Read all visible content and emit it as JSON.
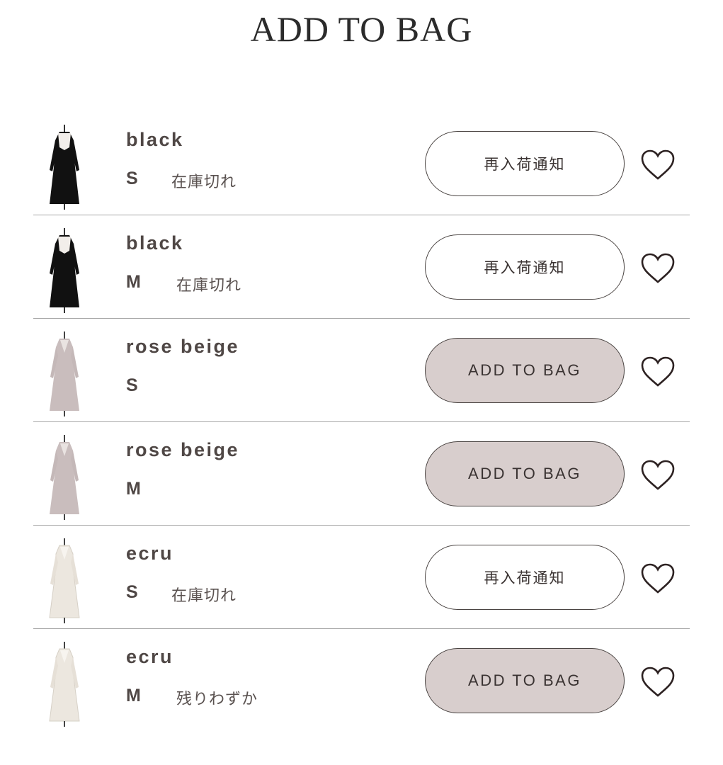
{
  "page": {
    "title": "ADD TO BAG"
  },
  "colors": {
    "black_dress": "#111111",
    "rose_beige_dress": "#c9bdbd",
    "ecru_dress": "#ece7df",
    "button_fill": "#d8cecd"
  },
  "items": [
    {
      "color": "black",
      "size": "S",
      "stock": "在庫切れ",
      "button": "再入荷通知",
      "dress": "black-dress-image"
    },
    {
      "color": "black",
      "size": "M",
      "stock": "在庫切れ",
      "button": "再入荷通知",
      "dress": "black-dress-image"
    },
    {
      "color": "rose beige",
      "size": "S",
      "stock": "",
      "button": "ADD TO BAG",
      "dress": "rose-beige-dress-image"
    },
    {
      "color": "rose beige",
      "size": "M",
      "stock": "",
      "button": "ADD TO BAG",
      "dress": "rose-beige-dress-image"
    },
    {
      "color": "ecru",
      "size": "S",
      "stock": "在庫切れ",
      "button": "再入荷通知",
      "dress": "ecru-dress-image"
    },
    {
      "color": "ecru",
      "size": "M",
      "stock": "残りわずか",
      "button": "ADD TO BAG",
      "dress": "ecru-dress-image"
    }
  ]
}
